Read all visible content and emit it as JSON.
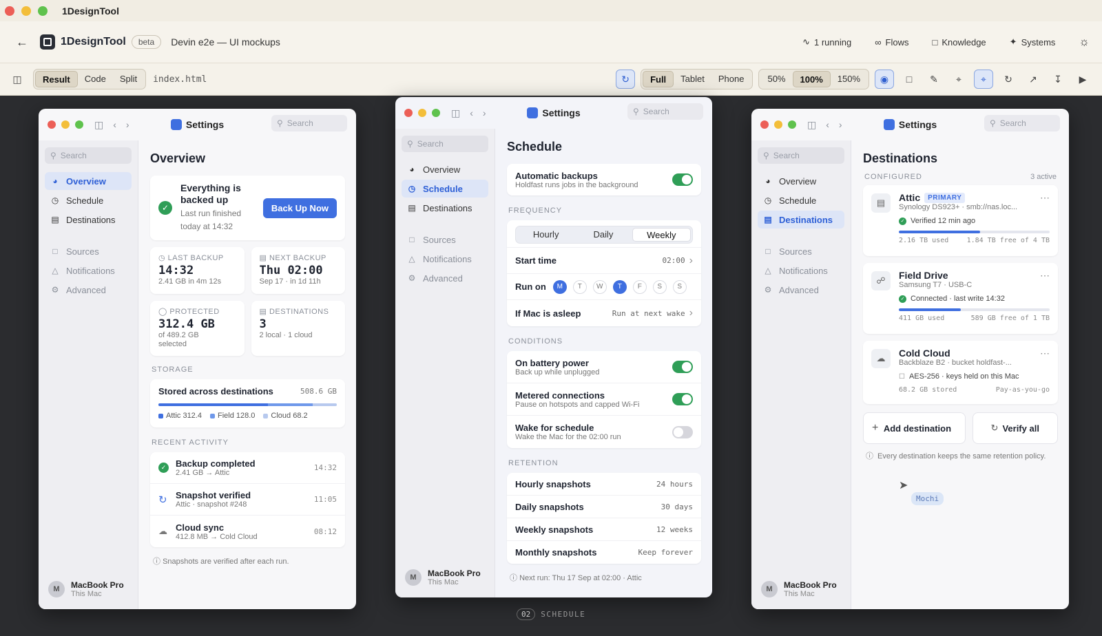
{
  "os": {
    "app_title": "1DesignTool",
    "colors": {
      "close": "#ec5f57",
      "minimize": "#f3be3a",
      "zoom": "#5fc24d"
    }
  },
  "header": {
    "back_icon": "arrow-left-icon",
    "app_name": "1DesignTool",
    "badge": "beta",
    "project": "Devin e2e — UI mockups",
    "running": "1 running",
    "flows": "Flows",
    "knowledge": "Knowledge",
    "systems": "Systems"
  },
  "toolbar": {
    "view_modes": [
      "Result",
      "Code",
      "Split"
    ],
    "active_view": "Result",
    "file": "index.html",
    "devices": [
      "Full",
      "Tablet",
      "Phone"
    ],
    "active_device": "Full",
    "zooms": [
      "50%",
      "100%",
      "150%"
    ],
    "active_zoom": "100%"
  },
  "common": {
    "window_title": "Settings",
    "search": "Search",
    "nav_primary": [
      "Overview",
      "Schedule",
      "Destinations"
    ],
    "nav_secondary": [
      "Sources",
      "Notifications",
      "Advanced"
    ],
    "device_name": "MacBook Pro",
    "device_sub": "This Mac",
    "avatar_letter": "M"
  },
  "overview": {
    "title": "Overview",
    "status_title": "Everything is backed up",
    "status_sub": "Last run finished today at 14:32",
    "backup_button": "Back Up Now",
    "last_backup_label": "LAST BACKUP",
    "last_backup_value": "14:32",
    "last_backup_sub": "2.41 GB in 4m 12s",
    "next_backup_label": "NEXT BACKUP",
    "next_backup_value": "Thu 02:00",
    "next_backup_sub": "Sep 17 · in 1d 11h",
    "protected_label": "PROTECTED",
    "protected_value": "312.4 GB",
    "protected_sub": "of 489.2 GB selected",
    "destinations_label": "DESTINATIONS",
    "destinations_value": "3",
    "destinations_sub": "2 local · 1 cloud",
    "storage_label": "STORAGE",
    "storage_title": "Stored across destinations",
    "storage_total": "508.6 GB",
    "storage_legend": [
      "Attic 312.4",
      "Field 128.0",
      "Cloud 68.2"
    ],
    "storage_values": [
      312.4,
      128.0,
      68.2
    ],
    "storage_colors": [
      "#3f6fe0",
      "#6f98ea",
      "#b7c9ee"
    ],
    "activity_label": "RECENT ACTIVITY",
    "activity": [
      {
        "title": "Backup completed",
        "sub": "2.41 GB → Attic",
        "time": "14:32"
      },
      {
        "title": "Snapshot verified",
        "sub": "Attic · snapshot #248",
        "time": "11:05"
      },
      {
        "title": "Cloud sync",
        "sub": "412.8 MB → Cold Cloud",
        "time": "08:12"
      }
    ],
    "footnote": "Snapshots are verified after each run."
  },
  "schedule": {
    "title": "Schedule",
    "auto_title": "Automatic backups",
    "auto_sub": "Holdfast runs jobs in the background",
    "auto_on": true,
    "freq_label": "FREQUENCY",
    "freq_options": [
      "Hourly",
      "Daily",
      "Weekly"
    ],
    "freq_active": "Weekly",
    "start_label": "Start time",
    "start_value": "02:00",
    "runon_label": "Run on",
    "days": [
      "M",
      "T",
      "W",
      "T",
      "F",
      "S",
      "S"
    ],
    "days_active": [
      true,
      false,
      false,
      true,
      false,
      false,
      false
    ],
    "asleep_label": "If Mac is asleep",
    "asleep_value": "Run at next wake",
    "cond_label": "CONDITIONS",
    "conditions": [
      {
        "title": "On battery power",
        "sub": "Back up while unplugged",
        "on": true
      },
      {
        "title": "Metered connections",
        "sub": "Pause on hotspots and capped Wi-Fi",
        "on": true
      },
      {
        "title": "Wake for schedule",
        "sub": "Wake the Mac for the 02:00 run",
        "on": false
      }
    ],
    "ret_label": "RETENTION",
    "retention": [
      {
        "title": "Hourly snapshots",
        "value": "24 hours"
      },
      {
        "title": "Daily snapshots",
        "value": "30 days"
      },
      {
        "title": "Weekly snapshots",
        "value": "12 weeks"
      },
      {
        "title": "Monthly snapshots",
        "value": "Keep forever"
      }
    ],
    "next_run": "Next run: Thu 17 Sep at 02:00 · Attic"
  },
  "destinations": {
    "title": "Destinations",
    "configured_label": "CONFIGURED",
    "active_count": "3 active",
    "items": [
      {
        "name": "Attic",
        "tag": "PRIMARY",
        "sub": "Synology DS923+ · smb://nas.loc...",
        "status": "Verified 12 min ago",
        "used": "2.16 TB used",
        "free": "1.84 TB free of 4 TB",
        "fill": 0.54
      },
      {
        "name": "Field Drive",
        "tag": "",
        "sub": "Samsung T7 · USB-C",
        "status": "Connected · last write 14:32",
        "used": "411 GB used",
        "free": "589 GB free of 1 TB",
        "fill": 0.41
      },
      {
        "name": "Cold Cloud",
        "tag": "",
        "sub": "Backblaze B2 · bucket holdfast-...",
        "status": "AES-256 · keys held on this Mac",
        "used": "68.2 GB stored",
        "free": "Pay-as-you-go",
        "fill": null
      }
    ],
    "add_button": "Add destination",
    "verify_button": "Verify all",
    "note": "Every destination keeps the same retention policy.",
    "cursor_label": "Mochi"
  },
  "canvas_label": {
    "num": "02",
    "text": "SCHEDULE"
  }
}
